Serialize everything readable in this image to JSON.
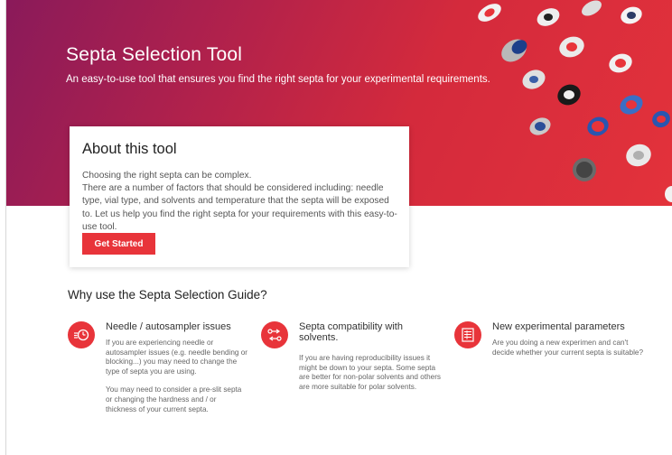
{
  "hero": {
    "title": "Septa Selection Tool",
    "subtitle": "An easy-to-use tool that ensures you find the right septa for your experimental requirements."
  },
  "about": {
    "title": "About this tool",
    "para1": "Choosing the right septa can be complex.",
    "para2": "There are a number of factors that should be considered including: needle type, vial type, and solvents and temperature that the septa will be exposed to. Let us help you find the right septa for your requirements with this easy-to-use tool.",
    "button_label": "Get Started"
  },
  "why": {
    "title": "Why use the Septa Selection Guide?",
    "features": [
      {
        "icon": "needle-timer-icon",
        "title": "Needle / autosampler issues",
        "text1": "If you are experiencing needle or autosampler issues (e.g. needle bending or blocking...) you may need to change the type of septa you are using.",
        "text2": "You may need to consider a pre-slit septa or changing the hardness and / or thickness of your current septa."
      },
      {
        "icon": "compatibility-icon",
        "title": "Septa compatibility with solvents.",
        "text1": "If you are having reproducibility issues it might be down to your septa. Some septa are better for non-polar solvents and others are more suitable for polar solvents."
      },
      {
        "icon": "parameters-icon",
        "title": "New experimental parameters",
        "text1": "Are you doing a new experimen and can't decide whether your current septa is suitable?"
      }
    ]
  },
  "colors": {
    "accent": "#e8343a",
    "hero_start": "#8a1a5a",
    "hero_end": "#e3323b"
  }
}
